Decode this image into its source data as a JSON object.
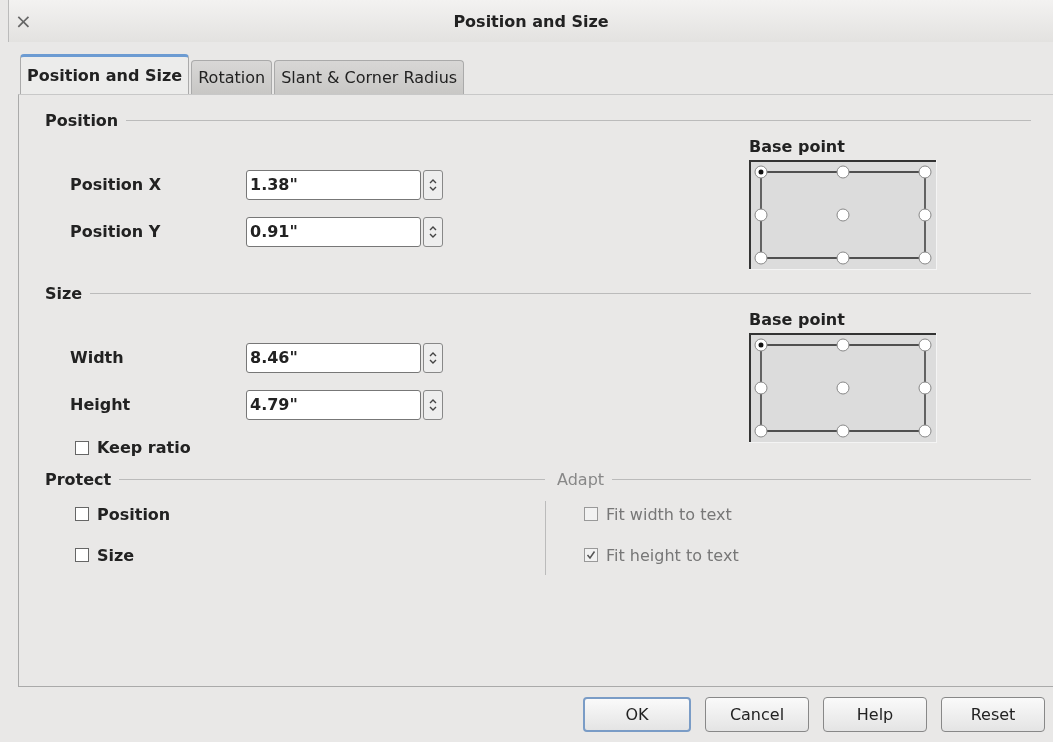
{
  "window": {
    "title": "Position and Size",
    "close_glyph": "×"
  },
  "tabs": [
    {
      "label": "Position and Size",
      "selected": true
    },
    {
      "label": "Rotation",
      "selected": false
    },
    {
      "label": "Slant & Corner Radius",
      "selected": false
    }
  ],
  "sections": [
    {
      "heading": "Position",
      "fields": [
        {
          "label": "Position X",
          "value": "1.38\""
        },
        {
          "label": "Position Y",
          "value": "0.91\""
        }
      ],
      "base_point": {
        "label": "Base point",
        "points": [
          {
            "selected": true
          },
          {
            "selected": false
          },
          {
            "selected": false
          },
          {
            "selected": false
          },
          {
            "selected": false
          },
          {
            "selected": false
          },
          {
            "selected": false
          },
          {
            "selected": false
          },
          {
            "selected": false
          }
        ]
      }
    },
    {
      "heading": "Size",
      "fields": [
        {
          "label": "Width",
          "value": "8.46\""
        },
        {
          "label": "Height",
          "value": "4.79\""
        }
      ],
      "base_point": {
        "label": "Base point",
        "points": [
          {
            "selected": true
          },
          {
            "selected": false
          },
          {
            "selected": false
          },
          {
            "selected": false
          },
          {
            "selected": false
          },
          {
            "selected": false
          },
          {
            "selected": false
          },
          {
            "selected": false
          },
          {
            "selected": false
          }
        ]
      },
      "checkboxes": [
        {
          "label": "Keep ratio",
          "checked": false,
          "disabled": false
        }
      ]
    }
  ],
  "protect": {
    "heading": "Protect",
    "checkboxes": [
      {
        "label": "Position",
        "checked": false,
        "disabled": false
      },
      {
        "label": "Size",
        "checked": false,
        "disabled": false
      }
    ]
  },
  "adapt": {
    "heading": "Adapt",
    "disabled": true,
    "checkboxes": [
      {
        "label": "Fit width to text",
        "checked": false,
        "disabled": true
      },
      {
        "label": "Fit height to text",
        "checked": true,
        "disabled": true
      }
    ]
  },
  "buttons": [
    {
      "label": "OK",
      "default": true
    },
    {
      "label": "Cancel",
      "default": false
    },
    {
      "label": "Help",
      "default": false
    },
    {
      "label": "Reset",
      "default": false
    }
  ]
}
